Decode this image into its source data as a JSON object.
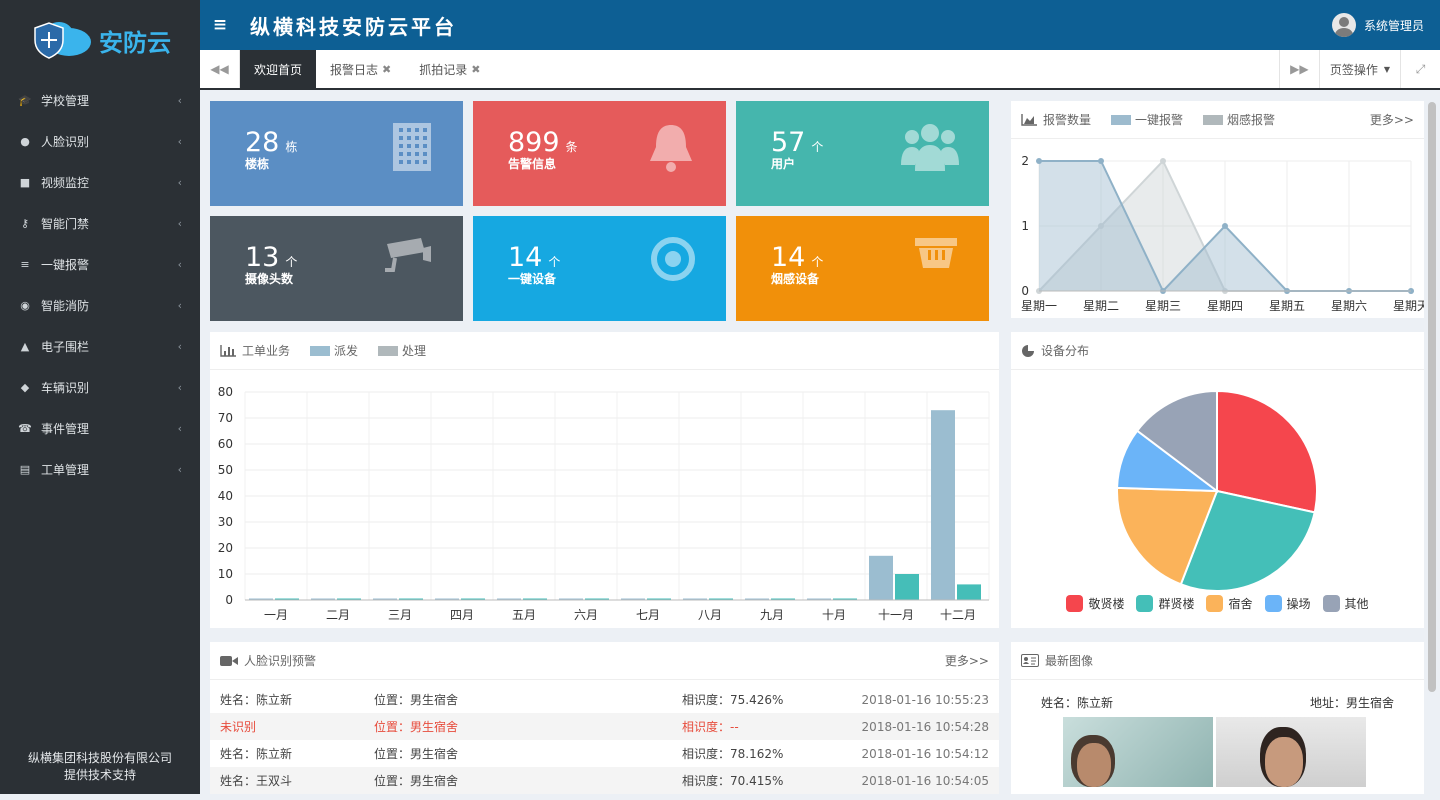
{
  "brand": {
    "logo_text": "安防云"
  },
  "sidebar": {
    "items": [
      {
        "label": "学校管理",
        "icon": "graduation-cap-icon",
        "glyph": "🎓"
      },
      {
        "label": "人脸识别",
        "icon": "user-circle-icon",
        "glyph": "●"
      },
      {
        "label": "视频监控",
        "icon": "video-camera-icon",
        "glyph": "■"
      },
      {
        "label": "智能门禁",
        "icon": "key-icon",
        "glyph": "⚷"
      },
      {
        "label": "一键报警",
        "icon": "database-icon",
        "glyph": "≡"
      },
      {
        "label": "智能消防",
        "icon": "fire-icon",
        "glyph": "◉"
      },
      {
        "label": "电子围栏",
        "icon": "warning-icon",
        "glyph": "▲"
      },
      {
        "label": "车辆识别",
        "icon": "car-icon",
        "glyph": "◆"
      },
      {
        "label": "事件管理",
        "icon": "phone-volume-icon",
        "glyph": "☎"
      },
      {
        "label": "工单管理",
        "icon": "book-icon",
        "glyph": "▤"
      }
    ],
    "footer_line1": "纵横集团科技股份有限公司",
    "footer_line2": "提供技术支持"
  },
  "header": {
    "title": "纵横科技安防云平台",
    "user": "系统管理员"
  },
  "tabs": {
    "items": [
      {
        "label": "欢迎首页"
      },
      {
        "label": "报警日志"
      },
      {
        "label": "抓拍记录"
      }
    ],
    "page_ops": "页签操作"
  },
  "stats": [
    {
      "value": "28",
      "unit": "栋",
      "label": "楼栋",
      "color": "#5b8ec4",
      "icon": "building-icon"
    },
    {
      "value": "899",
      "unit": "条",
      "label": "告警信息",
      "color": "#e55b5b",
      "icon": "bell-icon"
    },
    {
      "value": "57",
      "unit": "个",
      "label": "用户",
      "color": "#45b6ad",
      "icon": "users-icon"
    },
    {
      "value": "13",
      "unit": "个",
      "label": "摄像头数",
      "color": "#4c5760",
      "icon": "camera-icon"
    },
    {
      "value": "14",
      "unit": "个",
      "label": "一键设备",
      "color": "#16a8e1",
      "icon": "target-icon"
    },
    {
      "value": "14",
      "unit": "个",
      "label": "烟感设备",
      "color": "#f1900a",
      "icon": "smoke-detector-icon"
    }
  ],
  "alarm_panel": {
    "title": "报警数量",
    "legend": [
      "一键报警",
      "烟感报警"
    ],
    "more": "更多>>"
  },
  "workorder_panel": {
    "title": "工单业务",
    "legend": [
      "派发",
      "处理"
    ]
  },
  "device_panel": {
    "title": "设备分布"
  },
  "face_panel": {
    "title": "人脸识别预警",
    "more": "更多>>",
    "rows": [
      {
        "name": "姓名：陈立新",
        "loc": "位置：男生宿舍",
        "sim": "相识度：75.426%",
        "time": "2018-01-16 10:55:23",
        "red": false
      },
      {
        "name": "未识别",
        "loc": "位置：男生宿舍",
        "sim": "相识度：--",
        "time": "2018-01-16 10:54:28",
        "red": true
      },
      {
        "name": "姓名：陈立新",
        "loc": "位置：男生宿舍",
        "sim": "相识度：78.162%",
        "time": "2018-01-16 10:54:12",
        "red": false
      },
      {
        "name": "姓名：王双斗",
        "loc": "位置：男生宿舍",
        "sim": "相识度：70.415%",
        "time": "2018-01-16 10:54:05",
        "red": false
      }
    ]
  },
  "image_panel": {
    "title": "最新图像",
    "name": "姓名：陈立新",
    "address": "地址：男生宿舍"
  },
  "colors": {
    "series_a": "#9dbbce",
    "series_b": "#b0b8bb",
    "bar_a": "#9bbdd0",
    "bar_b": "#45beb8"
  },
  "chart_data": [
    {
      "type": "area",
      "categories": [
        "星期一",
        "星期二",
        "星期三",
        "星期四",
        "星期五",
        "星期六",
        "星期天"
      ],
      "series": [
        {
          "name": "一键报警",
          "values": [
            2,
            2,
            0,
            1,
            0,
            0,
            0
          ]
        },
        {
          "name": "烟感报警",
          "values": [
            0,
            1,
            2,
            0,
            0,
            0,
            0
          ]
        }
      ],
      "ylim": [
        0,
        2
      ],
      "yticks": [
        0,
        1,
        2
      ]
    },
    {
      "type": "bar",
      "categories": [
        "一月",
        "二月",
        "三月",
        "四月",
        "五月",
        "六月",
        "七月",
        "八月",
        "九月",
        "十月",
        "十一月",
        "十二月"
      ],
      "series": [
        {
          "name": "派发",
          "values": [
            0,
            0,
            0,
            0,
            0,
            0,
            0,
            0,
            0,
            0,
            17,
            73
          ]
        },
        {
          "name": "处理",
          "values": [
            0,
            0,
            0,
            0,
            0,
            0,
            0,
            0,
            0,
            0,
            10,
            6
          ]
        }
      ],
      "ylim": [
        0,
        80
      ],
      "yticks": [
        0,
        10,
        20,
        30,
        40,
        50,
        60,
        70,
        80
      ]
    },
    {
      "type": "pie",
      "labels": [
        "敬贤楼",
        "群贤楼",
        "宿舍",
        "操场",
        "其他"
      ],
      "values": [
        29,
        28,
        20,
        10,
        15
      ],
      "colors": [
        "#f5464d",
        "#44bfb8",
        "#fbb35a",
        "#6bb4f8",
        "#98a3b6"
      ]
    }
  ]
}
